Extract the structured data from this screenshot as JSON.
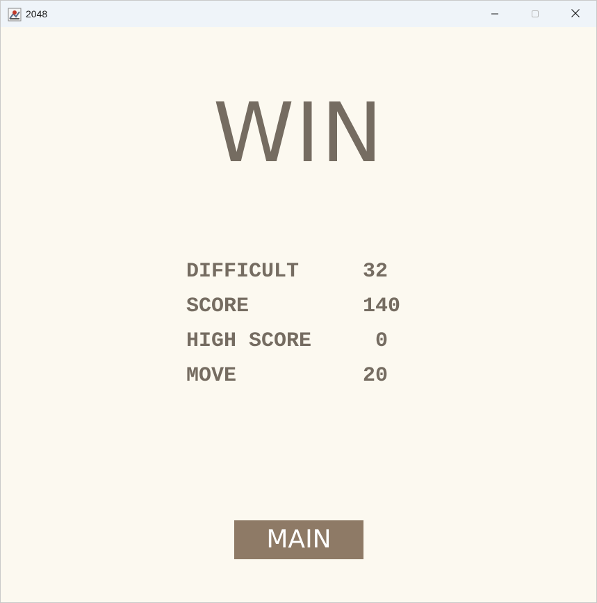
{
  "window": {
    "title": "2048"
  },
  "screen": {
    "heading": "WIN"
  },
  "stats": [
    {
      "label": "DIFFICULT",
      "value": "32"
    },
    {
      "label": "SCORE",
      "value": "140"
    },
    {
      "label": "HIGH SCORE",
      "value": " 0"
    },
    {
      "label": "MOVE",
      "value": "20"
    }
  ],
  "actions": {
    "main_label": "MAIN"
  },
  "colors": {
    "background": "#fcf9f0",
    "text": "#756c61",
    "button": "#8e7a66",
    "titlebar": "#eff4f9"
  },
  "icons": {
    "app": "java-app-icon",
    "minimize": "minimize-icon",
    "maximize": "maximize-icon",
    "close": "close-icon"
  }
}
